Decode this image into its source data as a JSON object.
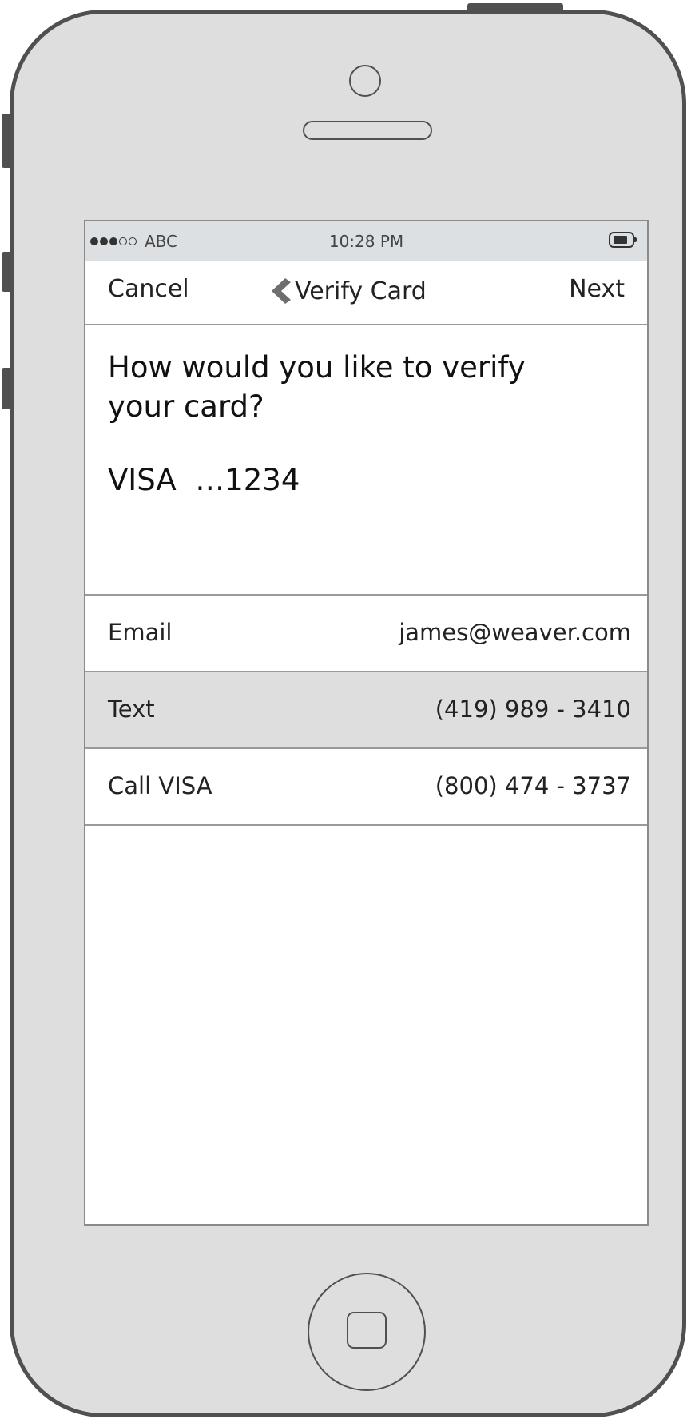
{
  "status_bar": {
    "carrier": "ABC",
    "time": "10:28 PM",
    "signal_bars_filled": 3,
    "signal_bars_total": 5
  },
  "nav": {
    "cancel_label": "Cancel",
    "title": "Verify Card",
    "next_label": "Next"
  },
  "prompt": {
    "question": "How would you like to verify your card?",
    "card": "VISA  …1234"
  },
  "options": [
    {
      "label": "Email",
      "value": "james@weaver.com",
      "selected": false
    },
    {
      "label": "Text",
      "value": "(419) 989 - 3410",
      "selected": true
    },
    {
      "label": "Call VISA",
      "value": "(800) 474 - 3737",
      "selected": false
    }
  ],
  "colors": {
    "phone_body": "#dedede",
    "phone_outline": "#505050",
    "status_bar_bg": "#dde0e3",
    "selected_row_bg": "#dedede",
    "divider": "#9a9a9a"
  }
}
